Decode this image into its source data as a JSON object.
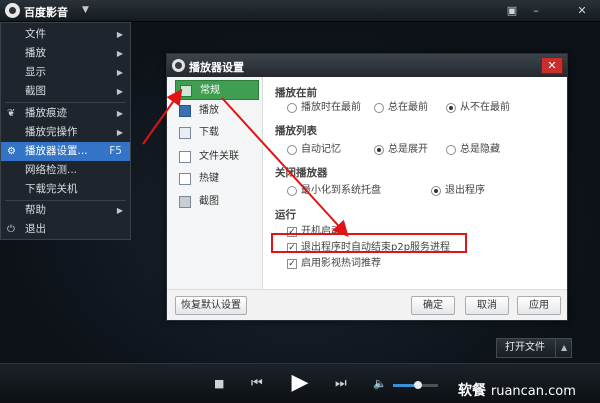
{
  "app": {
    "title": "百度影音",
    "title_arrow": "▼",
    "win_buttons": [
      "▣",
      "–",
      "✕"
    ]
  },
  "menu": {
    "items": [
      {
        "label": "文件",
        "icon": "",
        "arrow": "▶",
        "key": ""
      },
      {
        "label": "播放",
        "icon": "",
        "arrow": "▶",
        "key": ""
      },
      {
        "label": "显示",
        "icon": "",
        "arrow": "▶",
        "key": ""
      },
      {
        "label": "截图",
        "icon": "",
        "arrow": "▶",
        "key": ""
      },
      {
        "label": "播放痕迹",
        "icon": "❦",
        "arrow": "▶",
        "key": ""
      },
      {
        "label": "播放完操作",
        "icon": "",
        "arrow": "▶",
        "key": ""
      },
      {
        "label": "播放器设置...",
        "icon": "⚙",
        "arrow": "",
        "key": "F5"
      },
      {
        "label": "网络检测...",
        "icon": "",
        "arrow": "",
        "key": ""
      },
      {
        "label": "下载完关机",
        "icon": "",
        "arrow": "",
        "key": ""
      },
      {
        "label": "帮助",
        "icon": "",
        "arrow": "▶",
        "key": ""
      },
      {
        "label": "退出",
        "icon": "⏻",
        "arrow": "",
        "key": ""
      }
    ]
  },
  "dialog": {
    "title": "播放器设置",
    "close_symbol": "✕",
    "nav": [
      {
        "label": "常规"
      },
      {
        "label": "播放"
      },
      {
        "label": "下载"
      },
      {
        "label": "文件关联"
      },
      {
        "label": "热键"
      },
      {
        "label": "截图"
      }
    ],
    "sections": {
      "top": {
        "title": "播放在前",
        "options": [
          "播放时在最前",
          "总在最前",
          "从不在最前"
        ]
      },
      "playlist": {
        "title": "播放列表",
        "options": [
          "自动记忆",
          "总是展开",
          "总是隐藏"
        ]
      },
      "close": {
        "title": "关闭播放器",
        "options": [
          "最小化到系统托盘",
          "退出程序"
        ]
      },
      "run": {
        "title": "运行",
        "options": [
          "开机启动",
          "退出程序时自动结束p2p服务进程",
          "启用影视热词推荐"
        ]
      }
    },
    "buttons": {
      "reset": "恢复默认设置",
      "ok": "确定",
      "cancel": "取消",
      "apply": "应用"
    }
  },
  "controls": {
    "open_file": "打开文件",
    "open_arrow": "▲",
    "stop": "■",
    "prev": "⏮",
    "play": "▶",
    "next": "⏭",
    "volume_icon": "🔈",
    "volume_level": 0.55
  },
  "watermark": {
    "brand": "软餐",
    "domain": "ruancan.com"
  },
  "colors": {
    "highlight": "#e01414",
    "selected_nav": "#3f9e4f",
    "menu_active": "#3474c7"
  }
}
